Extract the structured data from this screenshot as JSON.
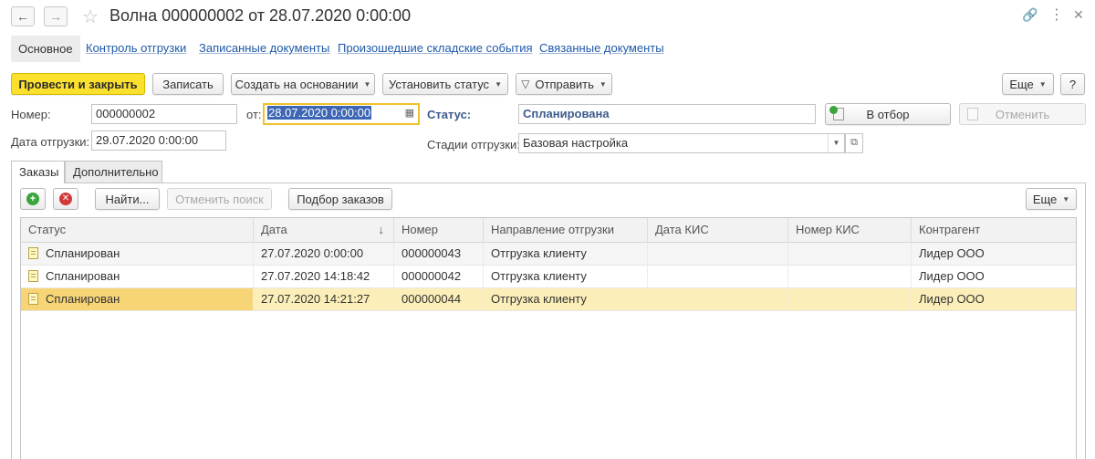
{
  "window": {
    "title": "Волна 000000002 от 28.07.2020 0:00:00",
    "back_icon": "←",
    "forward_icon": "→",
    "star_icon": "☆",
    "link_icon": "🔗",
    "menu_icon": "⋮",
    "close_icon": "✕"
  },
  "sections": {
    "main": "Основное",
    "shipment_control": "Контроль отгрузки",
    "recorded_docs": "Записанные документы",
    "warehouse_events": "Произошедшие складские события",
    "related_docs": "Связанные документы"
  },
  "toolbar": {
    "post_close": "Провести и закрыть",
    "save": "Записать",
    "create_based": "Создать на основании",
    "set_status": "Установить статус",
    "send": "Отправить",
    "more": "Еще",
    "help": "?"
  },
  "form": {
    "number_label": "Номер:",
    "number_value": "000000002",
    "from_label": "от:",
    "date_value": "28.07.2020  0:00:00",
    "ship_date_label": "Дата отгрузки:",
    "ship_date_value": "29.07.2020  0:00:00",
    "status_label": "Статус:",
    "status_value": "Спланирована",
    "in_filter": "В отбор",
    "cancel": "Отменить",
    "stages_label": "Стадии отгрузки:",
    "stages_value": "Базовая настройка"
  },
  "inner_tabs": {
    "orders": "Заказы",
    "additional": "Дополнительно"
  },
  "list_toolbar": {
    "find": "Найти...",
    "cancel_search": "Отменить поиск",
    "pick_orders": "Подбор заказов",
    "more": "Еще"
  },
  "table": {
    "columns": [
      "Статус",
      "Дата",
      "Номер",
      "Направление отгрузки",
      "Дата КИС",
      "Номер КИС",
      "Контрагент"
    ],
    "sort_icon": "↓",
    "rows": [
      {
        "status": "Спланирован",
        "date": "27.07.2020 0:00:00",
        "number": "000000043",
        "direction": "Отгрузка клиенту",
        "kis_date": "",
        "kis_number": "",
        "counterparty": "Лидер ООО"
      },
      {
        "status": "Спланирован",
        "date": "27.07.2020 14:18:42",
        "number": "000000042",
        "direction": "Отгрузка клиенту",
        "kis_date": "",
        "kis_number": "",
        "counterparty": "Лидер ООО"
      },
      {
        "status": "Спланирован",
        "date": "27.07.2020 14:21:27",
        "number": "000000044",
        "direction": "Отгрузка клиенту",
        "kis_date": "",
        "kis_number": "",
        "counterparty": "Лидер ООО"
      }
    ]
  },
  "colors": {
    "primary_button": "#fbe12e",
    "link": "#1e5aa8",
    "status_text": "#3c5b8c",
    "selected_row": "#fbeeb8",
    "add_icon": "#3aa53a",
    "remove_icon": "#d23a3a"
  }
}
